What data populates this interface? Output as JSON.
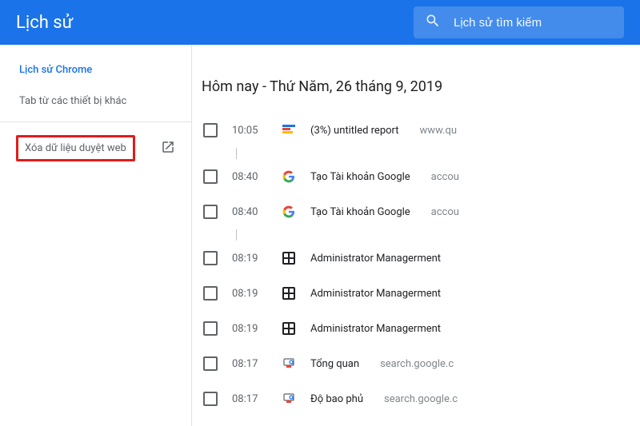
{
  "header": {
    "title": "Lịch sử",
    "search_placeholder": "Lịch sử tìm kiếm"
  },
  "sidebar": {
    "chrome_history": "Lịch sử Chrome",
    "tabs_other": "Tab từ các thiết bị khác",
    "clear_data": "Xóa dữ liệu duyệt web"
  },
  "main": {
    "date_header": "Hôm nay - Thứ Năm, 26 tháng 9, 2019",
    "rows": [
      {
        "time": "10:05",
        "icon": "quantrimang",
        "title": "(3%) untitled report",
        "url": "www.qu"
      },
      {
        "time": "08:40",
        "icon": "google",
        "title": "Tạo Tài khoản Google",
        "url": "accou"
      },
      {
        "time": "08:40",
        "icon": "google",
        "title": "Tạo Tài khoản Google",
        "url": "accou"
      },
      {
        "time": "08:19",
        "icon": "admin",
        "title": "Administrator Managerment",
        "url": ""
      },
      {
        "time": "08:19",
        "icon": "admin",
        "title": "Administrator Managerment",
        "url": ""
      },
      {
        "time": "08:19",
        "icon": "admin",
        "title": "Administrator Managerment",
        "url": ""
      },
      {
        "time": "08:17",
        "icon": "search-console",
        "title": "Tổng quan",
        "url": "search.google.c"
      },
      {
        "time": "08:17",
        "icon": "search-console",
        "title": "Độ bao phủ",
        "url": "search.google.c"
      }
    ]
  }
}
